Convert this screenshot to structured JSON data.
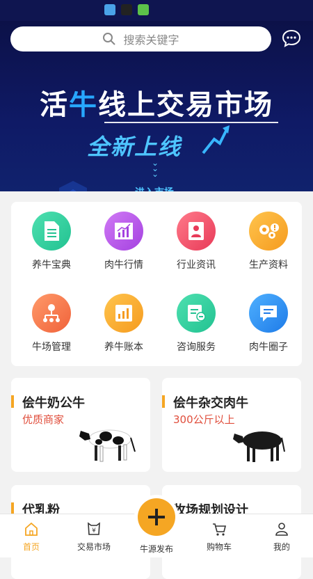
{
  "search": {
    "placeholder": "搜索关键字"
  },
  "banner": {
    "title_pre": "活",
    "title_highlight": "牛",
    "title_post": "线上交易市场",
    "subtitle": "全新上线",
    "enter_label": "进入市场"
  },
  "grid": [
    {
      "label": "养牛宝典",
      "icon": "document-icon",
      "color": "#2ecfa0"
    },
    {
      "label": "肉牛行情",
      "icon": "bar-chart-icon",
      "color": "#b455e8"
    },
    {
      "label": "行业资讯",
      "icon": "person-icon",
      "color": "#f0506a"
    },
    {
      "label": "生产资料",
      "icon": "gears-icon",
      "color": "#f5a623"
    },
    {
      "label": "牛场管理",
      "icon": "org-chart-icon",
      "color": "#f27a4a"
    },
    {
      "label": "养牛账本",
      "icon": "ledger-chart-icon",
      "color": "#f5a623"
    },
    {
      "label": "咨询服务",
      "icon": "consult-icon",
      "color": "#2ecfa0"
    },
    {
      "label": "肉牛圈子",
      "icon": "chat-bubble-icon",
      "color": "#2b8ff0"
    }
  ],
  "products": [
    {
      "title": "侩牛奶公牛",
      "subtitle": "优质商家"
    },
    {
      "title": "侩牛杂交肉牛",
      "subtitle": "300公斤以上"
    },
    {
      "title": "代乳粉",
      "subtitle": ""
    },
    {
      "title": "牧场规划设计",
      "subtitle": ""
    }
  ],
  "nav": [
    {
      "label": "首页",
      "icon": "home-icon"
    },
    {
      "label": "交易市场",
      "icon": "market-icon"
    },
    {
      "label": "牛源发布",
      "icon": "plus-icon"
    },
    {
      "label": "购物车",
      "icon": "cart-icon"
    },
    {
      "label": "我的",
      "icon": "profile-icon"
    }
  ],
  "colors": {
    "accent": "#f5a623",
    "banner_bg": "#0f1a66",
    "price_red": "#e04e3c"
  }
}
